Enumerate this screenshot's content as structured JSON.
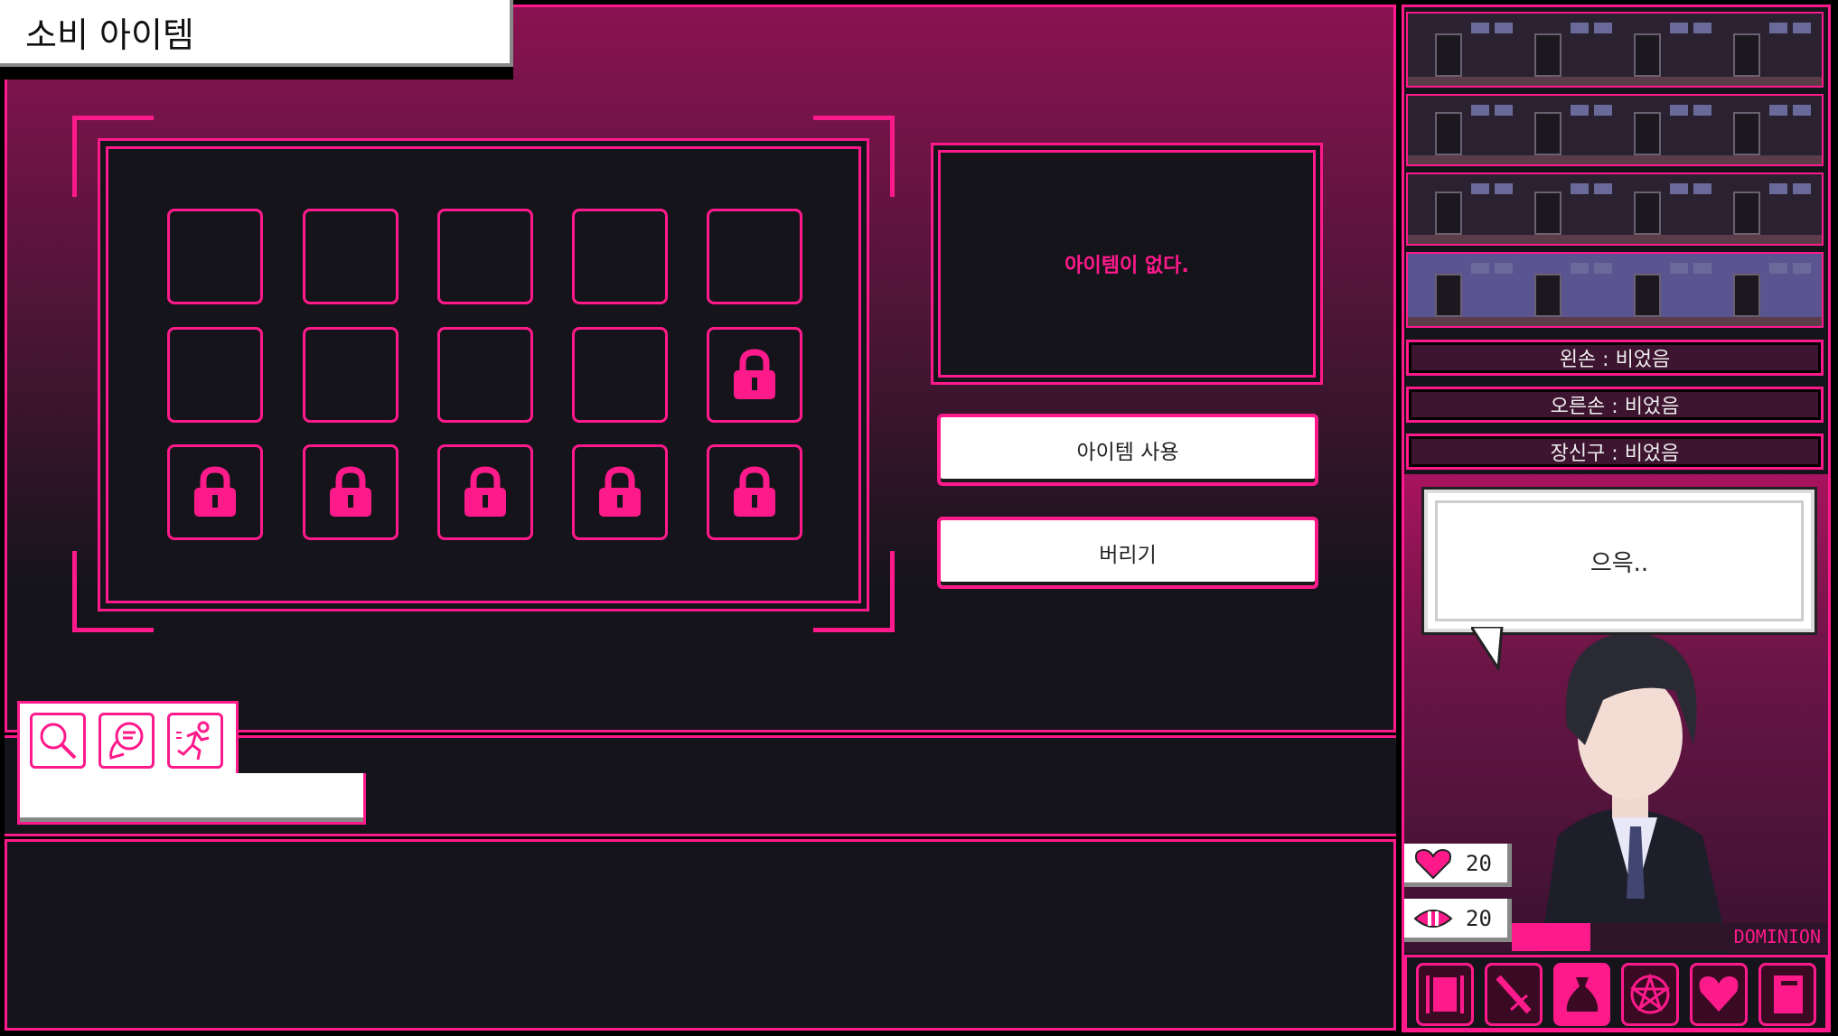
{
  "header": {
    "title": "소비 아이템"
  },
  "inventory": {
    "slots": [
      {
        "locked": false
      },
      {
        "locked": false
      },
      {
        "locked": false
      },
      {
        "locked": false
      },
      {
        "locked": false
      },
      {
        "locked": false
      },
      {
        "locked": false
      },
      {
        "locked": false
      },
      {
        "locked": false
      },
      {
        "locked": true
      },
      {
        "locked": true
      },
      {
        "locked": true
      },
      {
        "locked": true
      },
      {
        "locked": true
      },
      {
        "locked": true
      }
    ]
  },
  "item_panel": {
    "description": "아이템이 없다.",
    "use_label": "아이템 사용",
    "discard_label": "버리기"
  },
  "actions": [
    {
      "icon": "search-icon"
    },
    {
      "icon": "talk-icon"
    },
    {
      "icon": "run-icon"
    }
  ],
  "equipment": [
    "왼손 : 비었음",
    "오른손 : 비었음",
    "장신구 : 비었음"
  ],
  "dialogue": {
    "text": "으윽.."
  },
  "stats": {
    "health": "20",
    "sanity": "20",
    "dominion_label": "DOMINION",
    "dominion_fraction": 0.25
  },
  "toolbar": [
    {
      "icon": "armor-icon"
    },
    {
      "icon": "sword-icon"
    },
    {
      "icon": "bag-icon",
      "active": true
    },
    {
      "icon": "pentagram-icon"
    },
    {
      "icon": "heart-icon"
    },
    {
      "icon": "notebook-icon"
    }
  ],
  "colors": {
    "accent": "#ff1a8c",
    "panel": "#15141a"
  }
}
